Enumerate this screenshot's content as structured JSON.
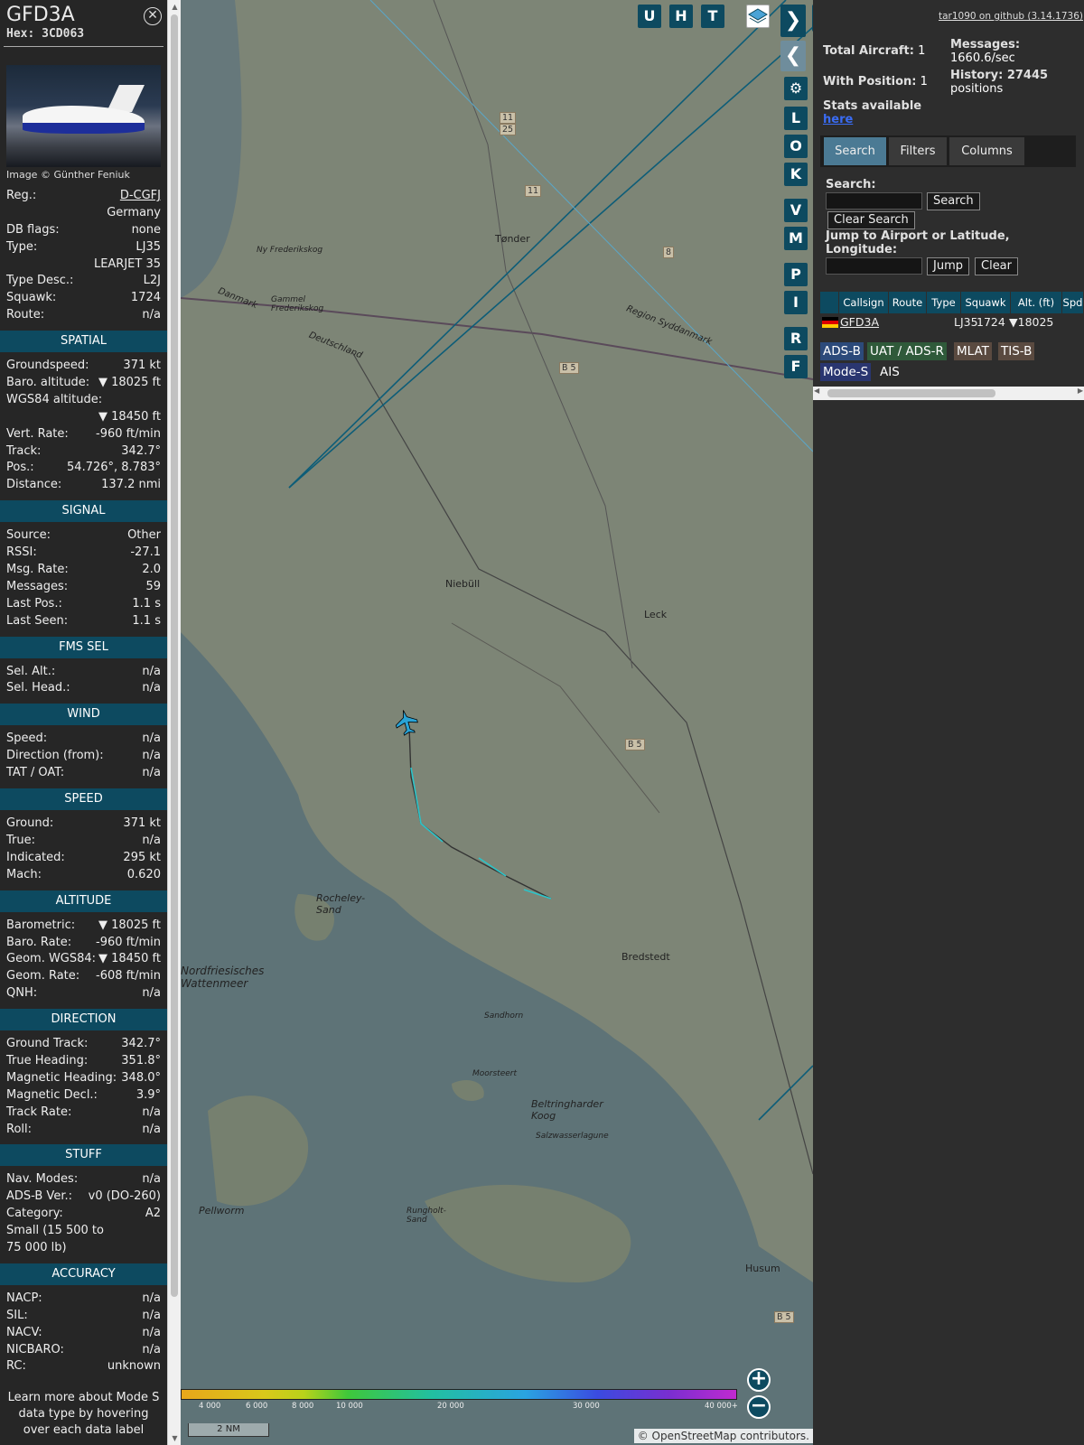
{
  "panel": {
    "callsign": "GFD3A",
    "hex": "Hex: 3CD063",
    "image_credit": "Image © Günther Feniuk",
    "info": [
      {
        "l": "Reg.:",
        "r": "D-CGFJ",
        "link": true
      },
      {
        "l": "",
        "r": "Germany"
      },
      {
        "l": "DB flags:",
        "r": "none"
      },
      {
        "l": "Type:",
        "r": "LJ35"
      },
      {
        "l": "",
        "r": "LEARJET 35"
      },
      {
        "l": "Type Desc.:",
        "r": "L2J"
      },
      {
        "l": "Squawk:",
        "r": "1724"
      },
      {
        "l": "Route:",
        "r": "n/a"
      }
    ],
    "sections": [
      {
        "title": "SPATIAL",
        "rows": [
          {
            "l": "Groundspeed:",
            "r": "371 kt"
          },
          {
            "l": "Baro. altitude:",
            "r": "▼ 18025 ft"
          },
          {
            "l": "WGS84 altitude:",
            "r": ""
          },
          {
            "l": "",
            "r": "▼ 18450 ft"
          },
          {
            "l": "Vert. Rate:",
            "r": "-960 ft/min"
          },
          {
            "l": "Track:",
            "r": "342.7°"
          },
          {
            "l": "Pos.:",
            "r": "54.726°, 8.783°"
          },
          {
            "l": "Distance:",
            "r": "137.2 nmi"
          }
        ]
      },
      {
        "title": "SIGNAL",
        "rows": [
          {
            "l": "Source:",
            "r": "Other"
          },
          {
            "l": "RSSI:",
            "r": "-27.1"
          },
          {
            "l": "Msg. Rate:",
            "r": "2.0"
          },
          {
            "l": "Messages:",
            "r": "59"
          },
          {
            "l": "Last Pos.:",
            "r": "1.1 s"
          },
          {
            "l": "Last Seen:",
            "r": "1.1 s"
          }
        ]
      },
      {
        "title": "FMS SEL",
        "rows": [
          {
            "l": "Sel. Alt.:",
            "r": "n/a"
          },
          {
            "l": "Sel. Head.:",
            "r": "n/a"
          }
        ]
      },
      {
        "title": "WIND",
        "rows": [
          {
            "l": "Speed:",
            "r": "n/a"
          },
          {
            "l": "Direction (from):",
            "r": "n/a"
          },
          {
            "l": "TAT / OAT:",
            "r": "n/a"
          }
        ]
      },
      {
        "title": "SPEED",
        "rows": [
          {
            "l": "Ground:",
            "r": "371 kt"
          },
          {
            "l": "True:",
            "r": "n/a"
          },
          {
            "l": "Indicated:",
            "r": "295 kt"
          },
          {
            "l": "Mach:",
            "r": "0.620"
          }
        ]
      },
      {
        "title": "ALTITUDE",
        "rows": [
          {
            "l": "Barometric:",
            "r": "▼ 18025 ft"
          },
          {
            "l": "Baro. Rate:",
            "r": "-960 ft/min"
          },
          {
            "l": "Geom. WGS84:",
            "r": "▼ 18450 ft"
          },
          {
            "l": "Geom. Rate:",
            "r": "-608 ft/min"
          },
          {
            "l": "QNH:",
            "r": "n/a"
          }
        ]
      },
      {
        "title": "DIRECTION",
        "rows": [
          {
            "l": "Ground Track:",
            "r": "342.7°"
          },
          {
            "l": "True Heading:",
            "r": "351.8°"
          },
          {
            "l": "Magnetic Heading:",
            "r": "348.0°"
          },
          {
            "l": "Magnetic Decl.:",
            "r": "3.9°"
          },
          {
            "l": "Track Rate:",
            "r": "n/a"
          },
          {
            "l": "Roll:",
            "r": "n/a"
          }
        ]
      },
      {
        "title": "STUFF",
        "rows": [
          {
            "l": "Nav. Modes:",
            "r": "n/a"
          },
          {
            "l": "ADS-B Ver.:",
            "r": "v0 (DO-260)"
          },
          {
            "l": "Category:",
            "r": "A2"
          },
          {
            "l": "Small (15 500 to",
            "r": ""
          },
          {
            "l": "75 000 lb)",
            "r": ""
          }
        ]
      },
      {
        "title": "ACCURACY",
        "rows": [
          {
            "l": "NACP:",
            "r": "n/a"
          },
          {
            "l": "SIL:",
            "r": "n/a"
          },
          {
            "l": "NACV:",
            "r": "n/a"
          },
          {
            "l": "NICBARO:",
            "r": "n/a"
          },
          {
            "l": "RC:",
            "r": "unknown"
          }
        ]
      }
    ],
    "footer_text": "Learn more about Mode S data type by hovering over each data label"
  },
  "map": {
    "buttons_top": [
      "U",
      "H",
      "T"
    ],
    "buttons_side": [
      "L",
      "O",
      "K",
      "V",
      "M",
      "P",
      "I",
      "R",
      "F"
    ],
    "places": [
      "Tønder",
      "Niebüll",
      "Leck",
      "Bredstedt",
      "Husum",
      "Pellworm",
      "Rocheley-Sand",
      "Beltringharder Koog",
      "Salzwasserlagune",
      "Sandhorn",
      "Moorsteert",
      "Rungholt-Sand",
      "Ny Frederikskog",
      "Gammel Frederikskog",
      "Deutschland",
      "Danmark",
      "Region Syddanmark",
      "Nordfriesisches Wattenmeer"
    ],
    "roads": [
      "11",
      "25",
      "11",
      "8",
      "B 5",
      "B 5",
      "B 5"
    ],
    "scale_label": "2 NM",
    "attribution": "© OpenStreetMap contributors.",
    "altitude_legend": [
      "4 000",
      "6 000",
      "8 000",
      "10 000",
      "20 000",
      "30 000",
      "40 000+"
    ]
  },
  "right": {
    "github": "tar1090 on github (3.14.1736)",
    "total_label": "Total Aircraft:",
    "total": "1",
    "withpos_label": "With Position:",
    "withpos": "1",
    "messages_label": "Messages:",
    "messages": "1660.6/sec",
    "history_label": "History: 27445",
    "history2": "positions",
    "stats_label": "Stats available",
    "stats_link": "here",
    "tabs": [
      "Search",
      "Filters",
      "Columns"
    ],
    "search_label": "Search:",
    "search_btn": "Search",
    "clear_search_btn": "Clear Search",
    "jump_label": "Jump to Airport or Latitude, Longitude:",
    "jump_btn": "Jump",
    "clear_btn": "Clear",
    "columns": [
      "Callsign",
      "Route",
      "Type",
      "Squawk",
      "Alt. (ft)",
      "Spd"
    ],
    "row": {
      "callsign": "GFD3A",
      "route": "",
      "type": "LJ35",
      "squawk": "1724",
      "alt": "▼18025"
    },
    "sources": [
      "ADS-B",
      "UAT / ADS-R",
      "MLAT",
      "TIS-B",
      "Mode-S",
      "AIS"
    ]
  }
}
